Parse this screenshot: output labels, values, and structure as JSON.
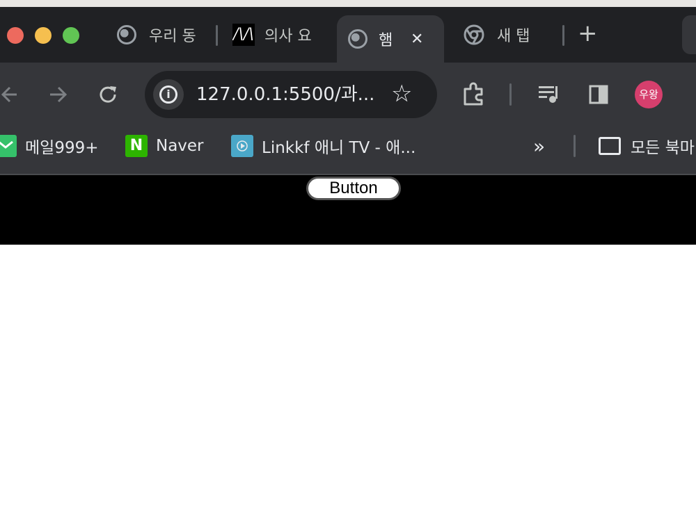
{
  "tabs": [
    {
      "title": "우리 동",
      "favicon": "globe-icon"
    },
    {
      "title": "의사 요",
      "favicon": "m-logo-icon"
    },
    {
      "title": "햄",
      "favicon": "globe-icon",
      "active": true,
      "close": "✕"
    },
    {
      "title": "새 탭",
      "favicon": "chrome-icon"
    }
  ],
  "new_tab": "+",
  "address_bar": {
    "url": "127.0.0.1:5500/과..."
  },
  "profile": {
    "avatar_text": "우왕",
    "color": "#d63f6d"
  },
  "bookmarks": [
    {
      "label": "메일999+",
      "icon": "mail-icon"
    },
    {
      "label": "Naver",
      "icon": "naver-icon",
      "icon_text": "N"
    },
    {
      "label": "Linkkf 애니 TV - 애...",
      "icon": "linkkf-icon"
    }
  ],
  "bookmarks_overflow": "»",
  "all_bookmarks": "모든 북마...",
  "page": {
    "button_label": "Button"
  }
}
